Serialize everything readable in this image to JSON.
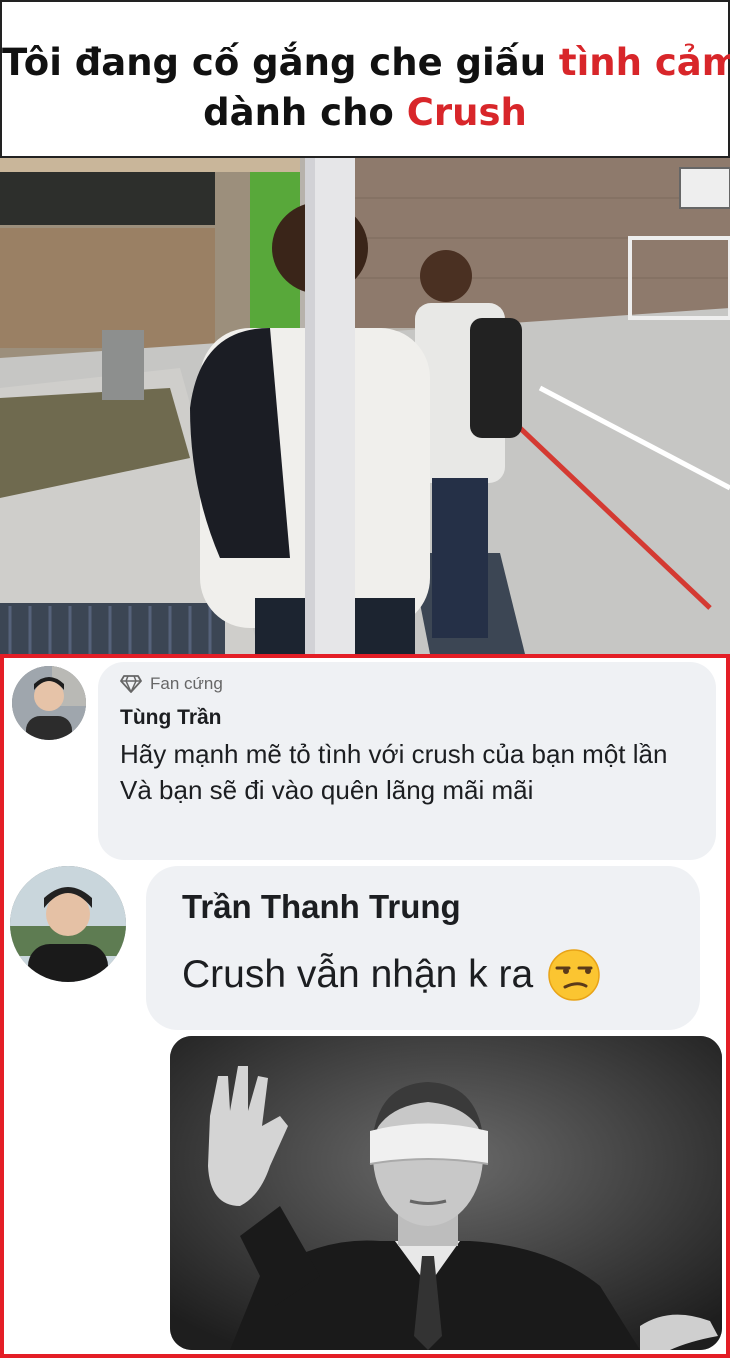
{
  "header": {
    "line1_plain": "Tôi đang cố gắng che giấu ",
    "line1_highlight": "tình cảm",
    "line2_plain": "dành cho ",
    "line2_highlight": "Crush",
    "highlight_color": "#d8262a"
  },
  "photo": {
    "icon": "photo-school-yard"
  },
  "comments": {
    "border_color": "#e41e26",
    "first": {
      "badge_icon": "diamond-icon",
      "badge_label": "Fan cứng",
      "author": "Tùng Trần",
      "text": "Hãy mạnh mẽ tỏ tình với crush của bạn một lần\nVà bạn sẽ đi vào quên lãng mãi mãi"
    },
    "second": {
      "author": "Trần Thanh Trung",
      "text": "Crush vẫn nhận k ra",
      "emoji": "unamused-face-emoji"
    },
    "sticker": {
      "icon": "blindfolded-man-image"
    }
  }
}
